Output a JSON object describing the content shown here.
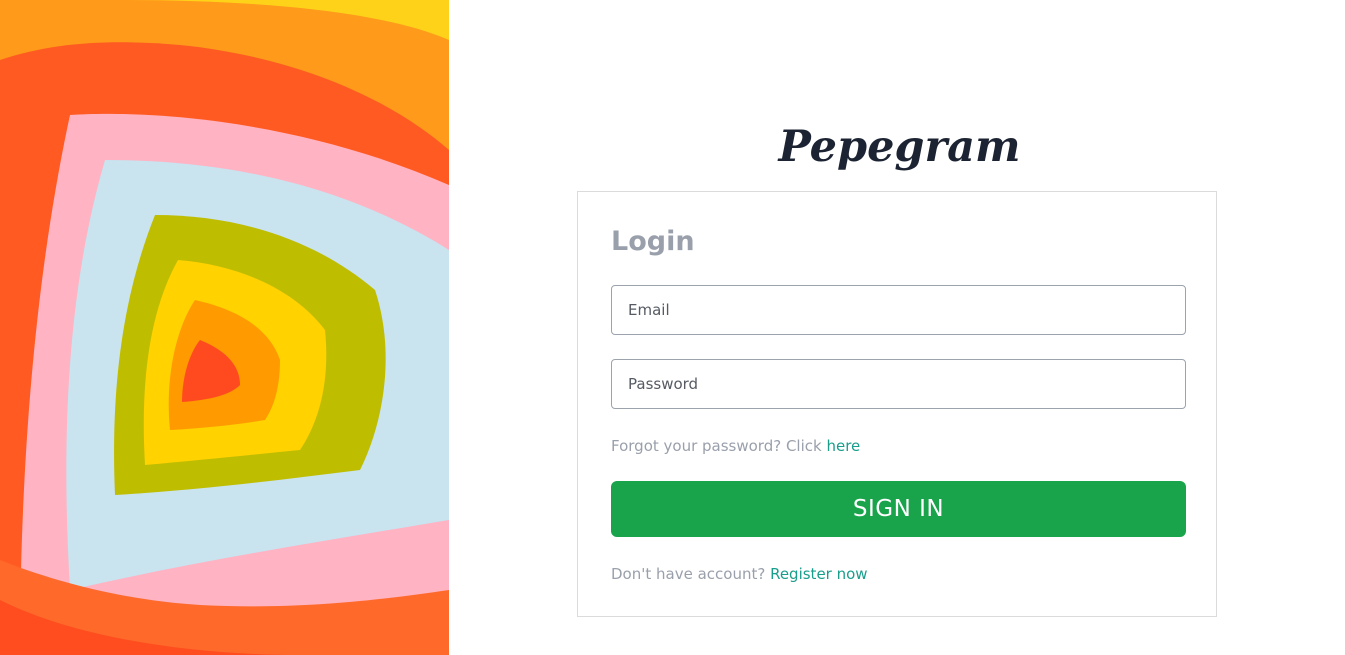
{
  "brand": {
    "name": "Pepegram"
  },
  "login": {
    "title": "Login",
    "email_placeholder": "Email",
    "password_placeholder": "Password",
    "forgot_prefix": "Forgot your password? Click ",
    "forgot_link": "here",
    "signin_label": "SIGN IN",
    "register_prefix": "Don't have account? ",
    "register_link": "Register now"
  },
  "colors": {
    "brand_text": "#1c2332",
    "title_gray": "#9aa0ab",
    "link": "#1a9e8c",
    "primary_button": "#19a44c"
  },
  "hero_image": {
    "icon": "abstract-rainbow-corner-art"
  }
}
